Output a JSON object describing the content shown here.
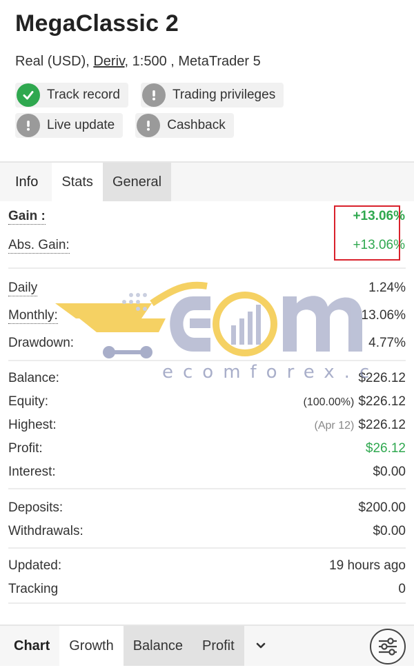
{
  "account": {
    "name": "MegaClassic 2",
    "type": "Real (USD),",
    "broker": "Deriv",
    "leverage_platform": ", 1:500 , MetaTrader 5"
  },
  "badges": [
    {
      "label": "Track record",
      "icon": "check-icon",
      "status": "verified"
    },
    {
      "label": "Trading privileges",
      "icon": "exclamation-icon",
      "status": "unverified"
    },
    {
      "label": "Live update",
      "icon": "exclamation-icon",
      "status": "unverified"
    },
    {
      "label": "Cashback",
      "icon": "exclamation-icon",
      "status": "unverified"
    }
  ],
  "tabs": [
    "Info",
    "Stats",
    "General"
  ],
  "stats": {
    "gain": {
      "label": "Gain :",
      "value": "+13.06%"
    },
    "abs_gain": {
      "label": "Abs. Gain:",
      "value": "+13.06%"
    },
    "daily": {
      "label": "Daily",
      "value": "1.24%"
    },
    "monthly": {
      "label": "Monthly:",
      "value": "13.06%"
    },
    "drawdown": {
      "label": "Drawdown:",
      "value": "4.77%"
    },
    "balance": {
      "label": "Balance:",
      "value": "$226.12"
    },
    "equity": {
      "label": "Equity:",
      "note": "(100.00%)",
      "value": "$226.12"
    },
    "highest": {
      "label": "Highest:",
      "note": "(Apr 12)",
      "value": "$226.12"
    },
    "profit": {
      "label": "Profit:",
      "value": "$26.12"
    },
    "interest": {
      "label": "Interest:",
      "value": "$0.00"
    },
    "deposits": {
      "label": "Deposits:",
      "value": "$200.00"
    },
    "withdrawals": {
      "label": "Withdrawals:",
      "value": "$0.00"
    },
    "updated": {
      "label": "Updated:",
      "value": "19 hours ago"
    },
    "tracking": {
      "label": "Tracking",
      "value": "0"
    }
  },
  "watermark": {
    "logo_text": "ECM",
    "site": "ecomforex.com"
  },
  "bottom_tabs": [
    "Chart",
    "Growth",
    "Balance",
    "Profit"
  ],
  "colors": {
    "green": "#2fa84f",
    "highlight_border": "#d9212b",
    "badge_grey": "#9a9a9a"
  }
}
